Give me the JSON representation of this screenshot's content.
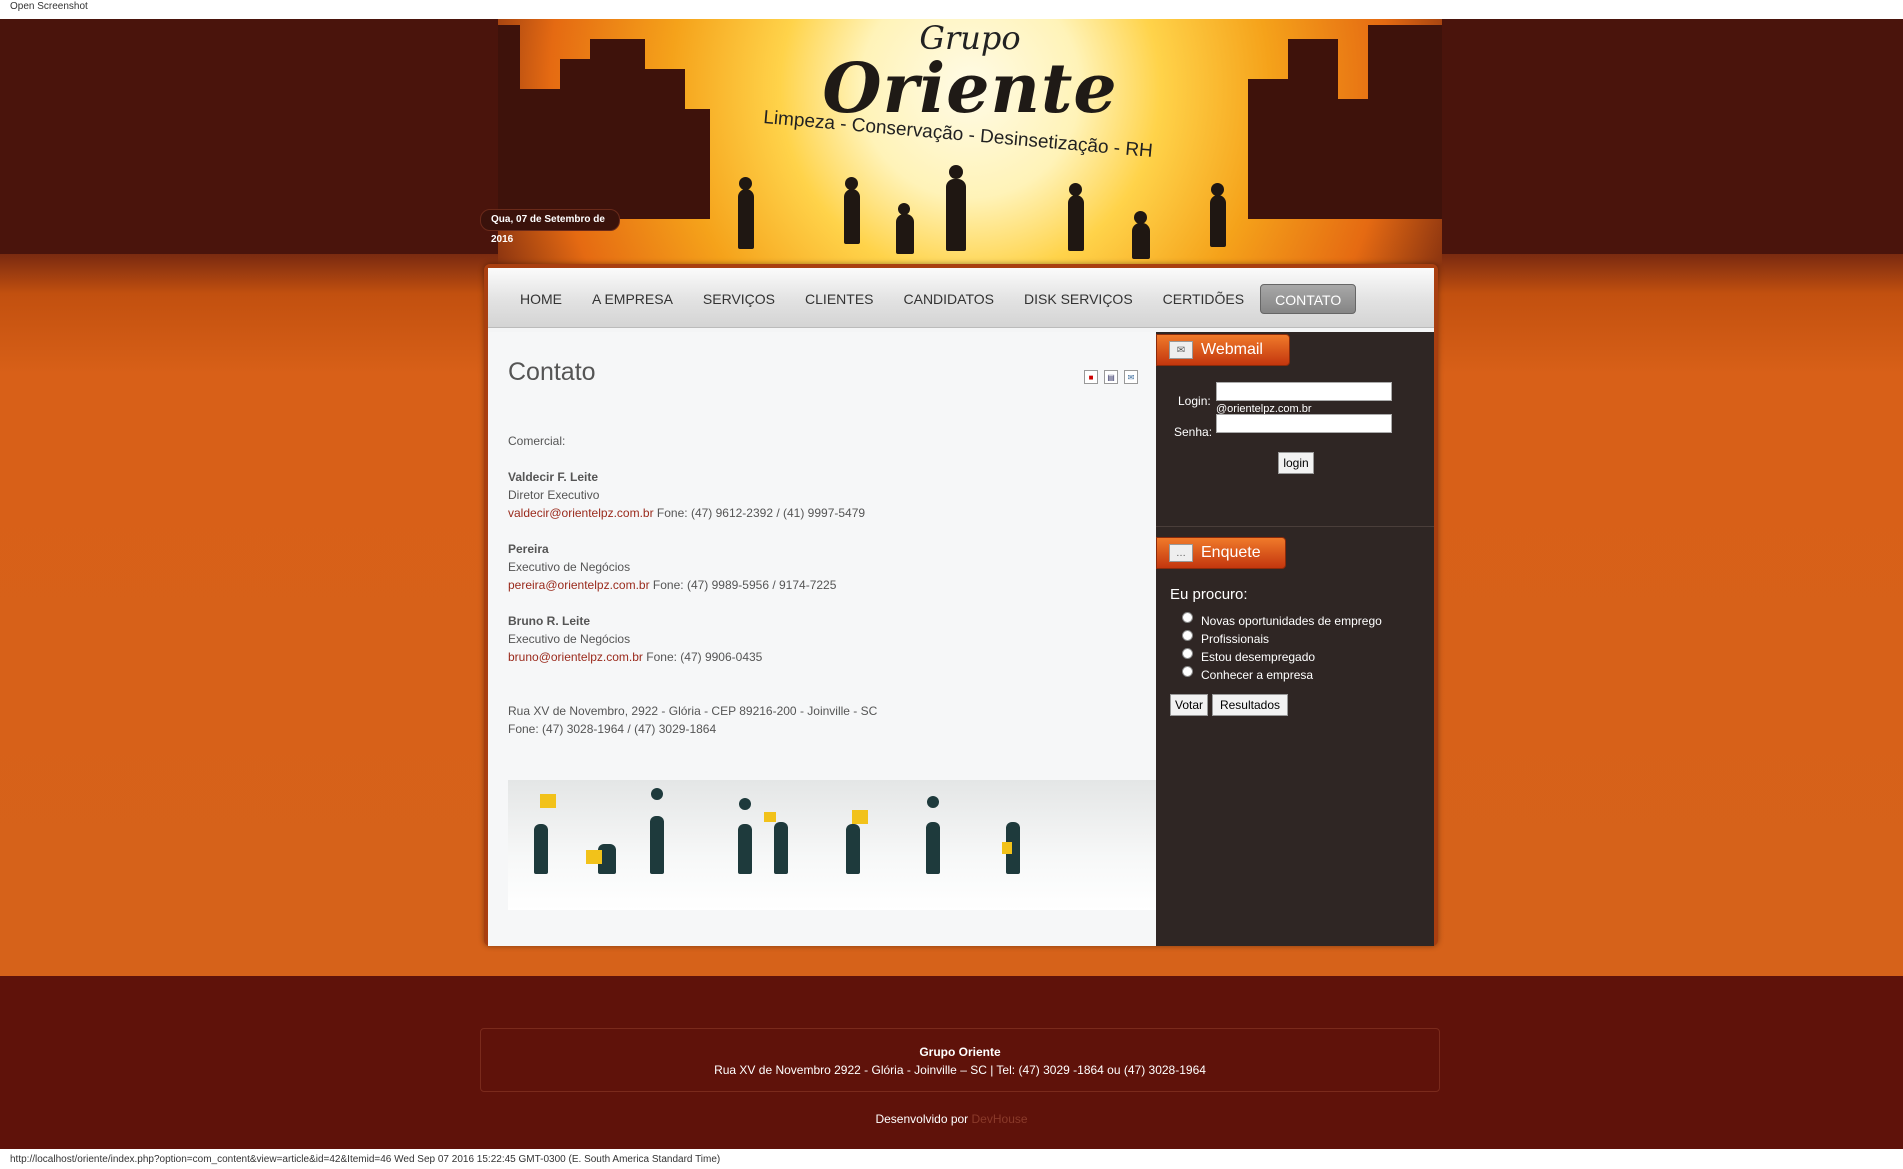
{
  "browser": {
    "top_label": "Open Screenshot",
    "status_url": "http://localhost/oriente/index.php?option=com_content&view=article&id=42&Itemid=46 Wed Sep 07 2016 15:22:45 GMT-0300 (E. South America Standard Time)"
  },
  "header": {
    "logo_small": "Grupo",
    "logo_large": "Oriente",
    "slogan": "Limpeza - Conservação - Desinsetização - RH",
    "date": "Qua, 07 de Setembro de 2016"
  },
  "nav": {
    "items": [
      {
        "label": "HOME"
      },
      {
        "label": "A EMPRESA"
      },
      {
        "label": "SERVIÇOS"
      },
      {
        "label": "CLIENTES"
      },
      {
        "label": "CANDIDATOS"
      },
      {
        "label": "DISK SERVIÇOS"
      },
      {
        "label": "CERTIDÕES"
      },
      {
        "label": "CONTATO"
      }
    ],
    "active": "CONTATO"
  },
  "article": {
    "title": "Contato",
    "icons": [
      "pdf-icon",
      "print-icon",
      "email-icon"
    ],
    "section": "Comercial:",
    "contacts": [
      {
        "name": "Valdecir F. Leite",
        "role": "Diretor Executivo",
        "email": "valdecir@orientelpz.com.br",
        "phone": "Fone: (47) 9612-2392 / (41) 9997-5479"
      },
      {
        "name": "Pereira",
        "role": "Executivo de Negócios",
        "email": "pereira@orientelpz.com.br",
        "phone": "Fone: (47) 9989-5956 / 9174-7225"
      },
      {
        "name": "Bruno R. Leite",
        "role": "Executivo de Negócios",
        "email": "bruno@orientelpz.com.br",
        "phone": "Fone: (47) 9906-0435"
      }
    ],
    "address": "Rua XV de Novembro, 2922 - Glória - CEP 89216-200 - Joinville - SC",
    "phones": "Fone: (47) 3028-1964 / (47) 3029-1864"
  },
  "webmail": {
    "title": "Webmail",
    "login_label": "Login:",
    "domain": "@orientelpz.com.br",
    "password_label": "Senha:",
    "login_button": "login",
    "login_value": "",
    "password_value": ""
  },
  "poll": {
    "title": "Enquete",
    "question": "Eu procuro:",
    "options": [
      "Novas oportunidades de emprego",
      "Profissionais",
      "Estou desempregado",
      "Conhecer a empresa"
    ],
    "vote_button": "Votar",
    "results_button": "Resultados"
  },
  "footer": {
    "company": "Grupo Oriente",
    "address": "Rua XV de Novembro 2922 - Glória - Joinville – SC | Tel: (47) 3029 -1864 ou (47) 3028-1964",
    "developed_prefix": "Desenvolvido por",
    "developer": "DevHouse"
  },
  "colors": {
    "header_dark": "#4a140c",
    "orange": "#d86018",
    "footer": "#5f120a",
    "sidebar": "#2f2624",
    "link": "#9a2a1c"
  }
}
